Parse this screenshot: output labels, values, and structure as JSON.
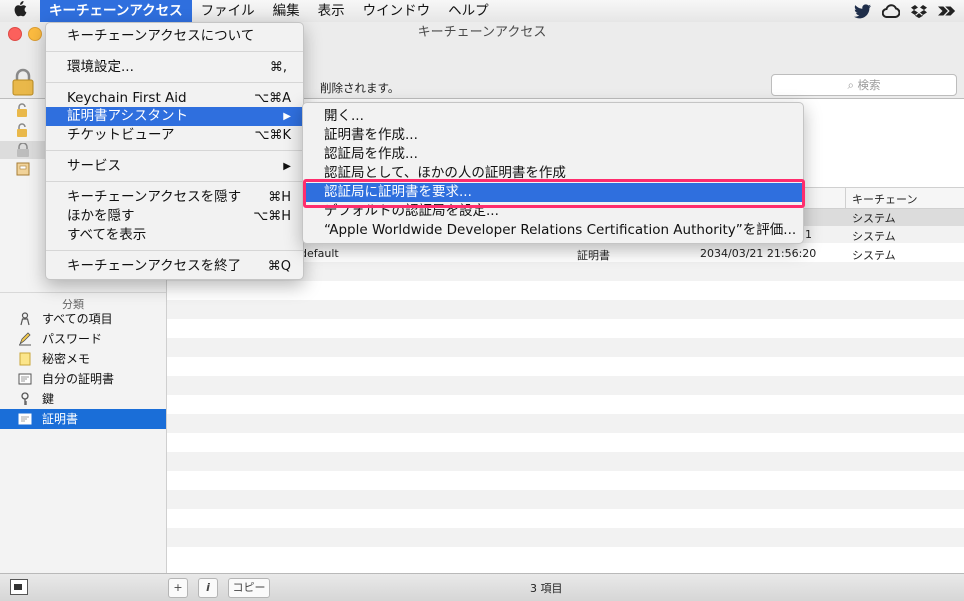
{
  "menubar": {
    "apple": "",
    "items": [
      "キーチェーンアクセス",
      "ファイル",
      "編集",
      "表示",
      "ウインドウ",
      "ヘルプ"
    ]
  },
  "window": {
    "title": "キーチェーンアクセス",
    "hint": "削除されます。",
    "search_placeholder": "検索"
  },
  "app_menu": {
    "items": [
      {
        "label": "キーチェーンアクセスについて",
        "shortcut": ""
      },
      {
        "label": "環境設定...",
        "shortcut": "⌘,"
      },
      {
        "label": "Keychain First Aid",
        "shortcut": "⌥⌘A"
      },
      {
        "label": "証明書アシスタント",
        "shortcut": "▶"
      },
      {
        "label": "チケットビューア",
        "shortcut": "⌥⌘K"
      },
      {
        "label": "サービス",
        "shortcut": "▶"
      },
      {
        "label": "キーチェーンアクセスを隠す",
        "shortcut": "⌘H"
      },
      {
        "label": "ほかを隠す",
        "shortcut": "⌥⌘H"
      },
      {
        "label": "すべてを表示",
        "shortcut": ""
      },
      {
        "label": "キーチェーンアクセスを終了",
        "shortcut": "⌘Q"
      }
    ]
  },
  "cert_submenu": {
    "items": [
      "開く...",
      "証明書を作成...",
      "認証局を作成...",
      "認証局として、ほかの人の証明書を作成",
      "認証局に証明書を要求...",
      "デフォルトの認証局を設定...",
      "“Apple Worldwide Developer Relations Certification Authority”を評価..."
    ]
  },
  "sidebar": {
    "category_header": "分類",
    "categories": [
      {
        "label": "すべての項目",
        "icon": "person-icon"
      },
      {
        "label": "パスワード",
        "icon": "pencil-icon"
      },
      {
        "label": "秘密メモ",
        "icon": "note-icon"
      },
      {
        "label": "自分の証明書",
        "icon": "certificate-icon"
      },
      {
        "label": "鍵",
        "icon": "key-icon"
      },
      {
        "label": "証明書",
        "icon": "certificate-icon"
      }
    ]
  },
  "table": {
    "columns": {
      "keychain": "キーチェーン"
    },
    "rows": [
      {
        "name": "",
        "kind": "",
        "date": "",
        "keychain": "システム"
      },
      {
        "name": "",
        "kind": "",
        "date": "1",
        "keychain": "システム"
      },
      {
        "name": "default",
        "kind": "証明書",
        "date": "2034/03/21 21:56:20",
        "keychain": "システム"
      }
    ]
  },
  "bottom": {
    "add": "+",
    "info": "i",
    "copy": "コピー",
    "count": "3 項目"
  }
}
